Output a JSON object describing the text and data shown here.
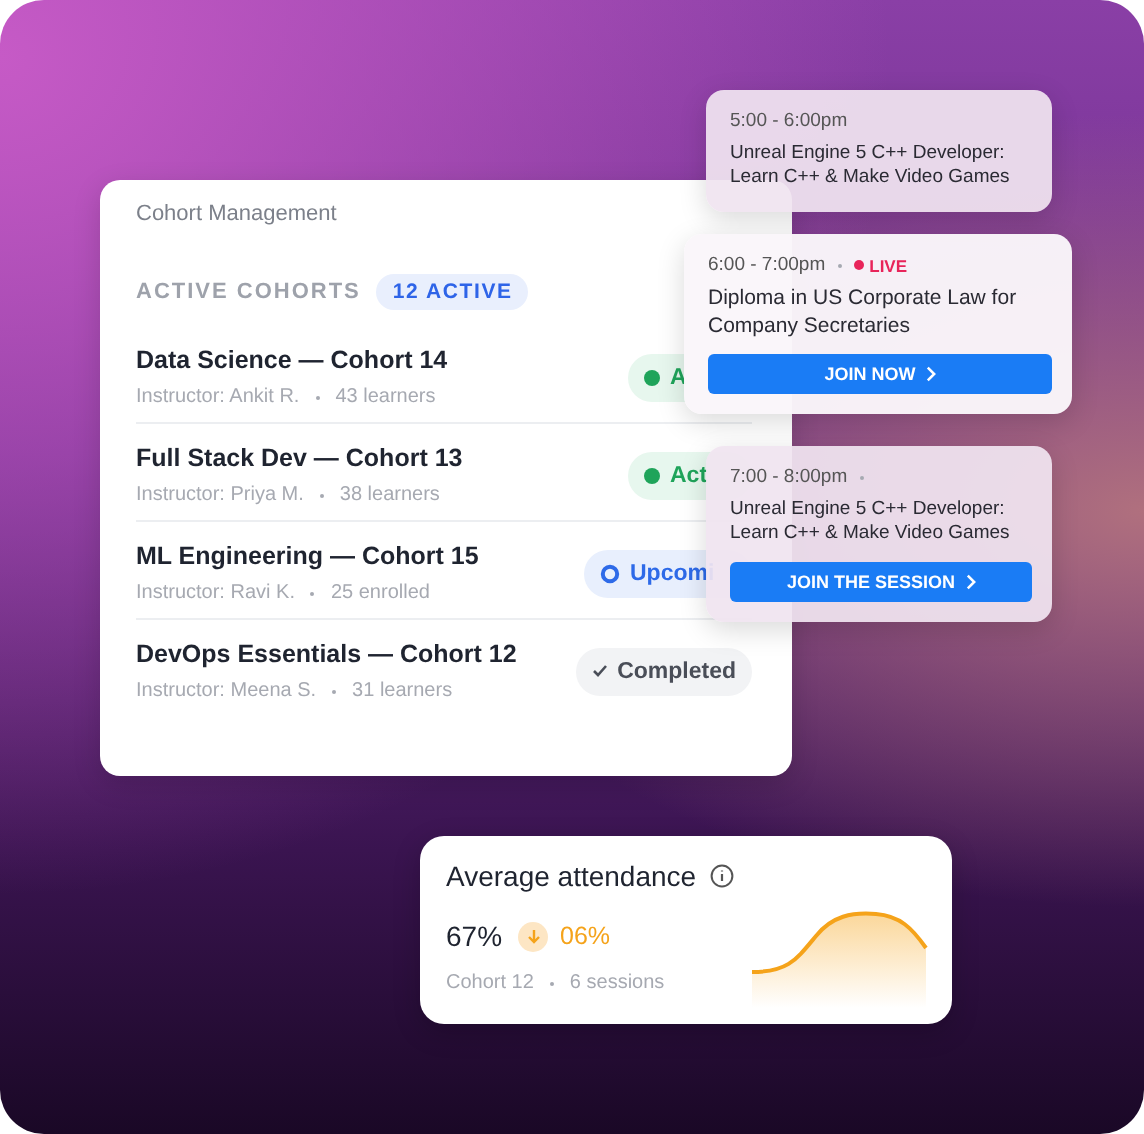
{
  "panel": {
    "title": "Cohort Management",
    "section_title": "ACTIVE COHORTS",
    "count_badge": "12 ACTIVE",
    "cohorts": [
      {
        "name": "Data Science — Cohort 14",
        "instructor": "Instructor: Ankit R.",
        "meta": "43 learners",
        "status": {
          "kind": "active",
          "label": "A"
        }
      },
      {
        "name": "Full Stack Dev — Cohort 13",
        "instructor": "Instructor: Priya M.",
        "meta": "38 learners",
        "status": {
          "kind": "active",
          "label": "Act"
        }
      },
      {
        "name": "ML Engineering — Cohort 15",
        "instructor": "Instructor: Ravi K.",
        "meta": "25 enrolled",
        "status": {
          "kind": "upcoming",
          "label": "Upcomi"
        }
      },
      {
        "name": "DevOps Essentials — Cohort 12",
        "instructor": "Instructor: Meena S.",
        "meta": "31 learners",
        "status": {
          "kind": "completed",
          "label": "Completed"
        }
      }
    ]
  },
  "sessions": [
    {
      "time": "5:00 - 6:00pm",
      "separator": false,
      "live": false,
      "title": "Unreal Engine 5 C++ Developer: Learn C++ & Make Video Games"
    },
    {
      "time": "6:00 - 7:00pm",
      "separator": true,
      "live": true,
      "live_label": "LIVE",
      "title": "Diploma in US Corporate Law for Company Secretaries",
      "button": "JOIN NOW"
    },
    {
      "time": "7:00 - 8:00pm",
      "separator": true,
      "live": false,
      "title": "Unreal Engine 5 C++ Developer: Learn C++ & Make Video Games",
      "button": "JOIN THE SESSION"
    }
  ],
  "attendance": {
    "title": "Average attendance",
    "value": "67%",
    "change": "06%",
    "cohort": "Cohort 12",
    "sessions": "6 sessions"
  }
}
